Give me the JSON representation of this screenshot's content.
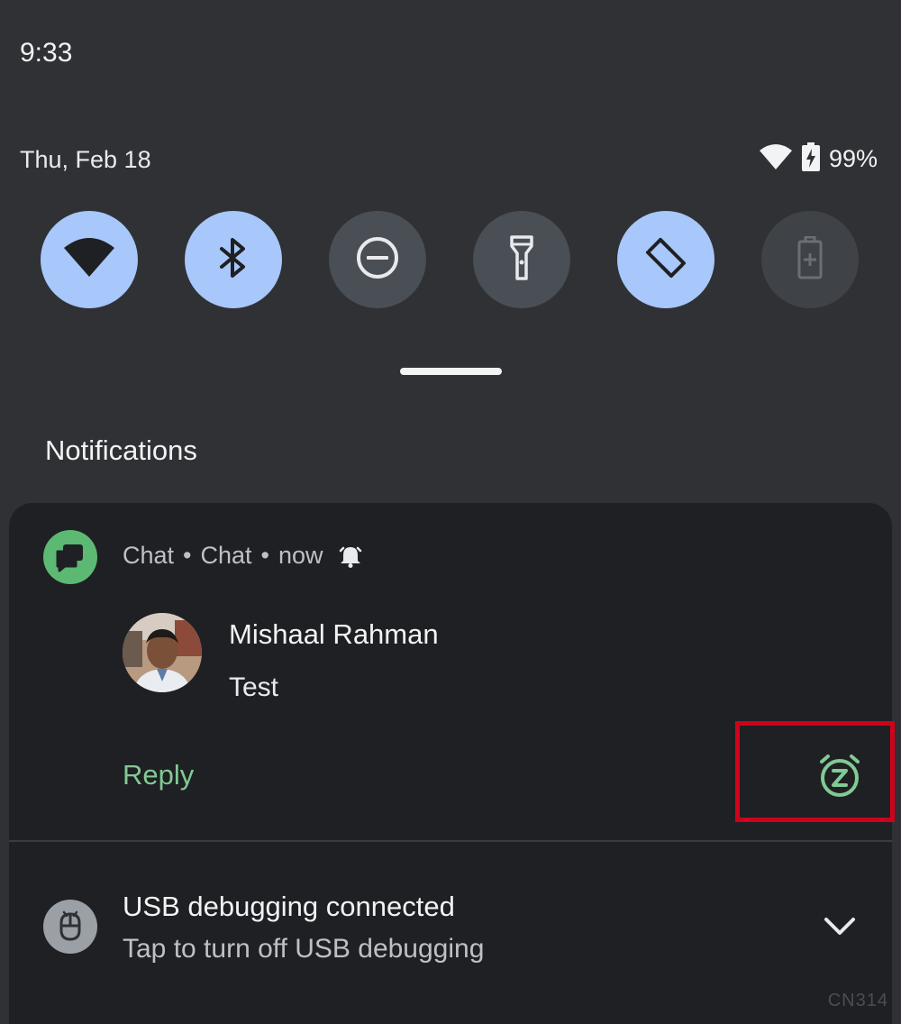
{
  "status_bar": {
    "time": "9:33",
    "date": "Thu, Feb 18",
    "battery_percent": "99%",
    "icons": [
      "wifi-icon",
      "battery-charging-icon"
    ]
  },
  "quick_settings": [
    {
      "name": "wifi",
      "icon": "wifi-icon",
      "state": "on"
    },
    {
      "name": "bluetooth",
      "icon": "bluetooth-icon",
      "state": "on"
    },
    {
      "name": "do-not-disturb",
      "icon": "do-not-disturb-icon",
      "state": "off"
    },
    {
      "name": "flashlight",
      "icon": "flashlight-icon",
      "state": "off"
    },
    {
      "name": "auto-rotate",
      "icon": "auto-rotate-icon",
      "state": "on"
    },
    {
      "name": "battery-saver",
      "icon": "battery-saver-icon",
      "state": "unavailable"
    }
  ],
  "notifications_title": "Notifications",
  "chat_notification": {
    "app_name": "Chat",
    "channel": "Chat",
    "time": "now",
    "sender": "Mishaal Rahman",
    "message": "Test",
    "reply_label": "Reply"
  },
  "usb_notification": {
    "title": "USB debugging connected",
    "subtitle": "Tap to turn off USB debugging"
  },
  "watermark": "CN314",
  "colors": {
    "background": "#2f3134",
    "card": "#1f2023",
    "tile_on": "#a8c7fa",
    "tile_off": "#4a4e55",
    "accent_green": "#81c995",
    "highlight_red": "#d0021b"
  }
}
